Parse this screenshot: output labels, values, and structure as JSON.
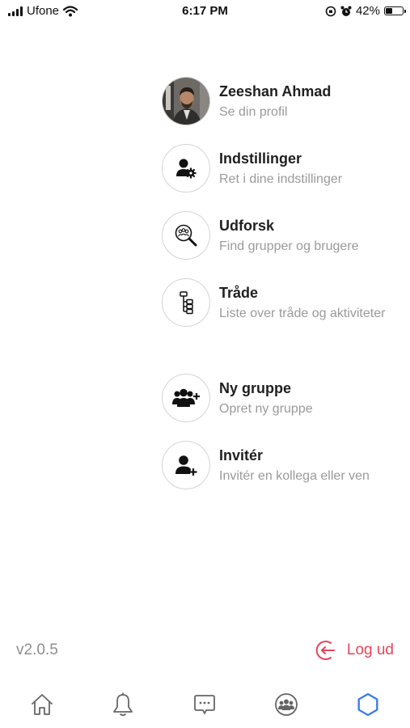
{
  "status_bar": {
    "carrier": "Ufone",
    "time": "6:17 PM",
    "battery_percent": "42%",
    "battery_level": 0.42
  },
  "menu": {
    "profile": {
      "name": "Zeeshan Ahmad",
      "subtitle": "Se din profil"
    },
    "items": [
      {
        "label": "Indstillinger",
        "subtitle": "Ret i dine indstillinger",
        "icon": "user-gear-icon"
      },
      {
        "label": "Udforsk",
        "subtitle": "Find grupper og brugere",
        "icon": "explore-search-icon"
      },
      {
        "label": "Tråde",
        "subtitle": "Liste over tråde og aktiviteter",
        "icon": "threads-icon"
      },
      {
        "label": "Ny gruppe",
        "subtitle": "Opret ny gruppe",
        "icon": "group-add-icon"
      },
      {
        "label": "Invitér",
        "subtitle": "Invitér en kollega eller ven",
        "icon": "user-add-icon"
      }
    ]
  },
  "footer": {
    "version": "v2.0.5",
    "logout_label": "Log ud"
  },
  "tabbar": {
    "tabs": [
      "home-icon",
      "bell-icon",
      "chat-icon",
      "groups-icon",
      "hexagon-icon"
    ],
    "active_tab": "hexagon-icon",
    "active_color": "#3f7de6",
    "inactive_color": "#666666"
  },
  "colors": {
    "accent_logout": "#e8435a",
    "subtitle": "#9a9a9a"
  }
}
